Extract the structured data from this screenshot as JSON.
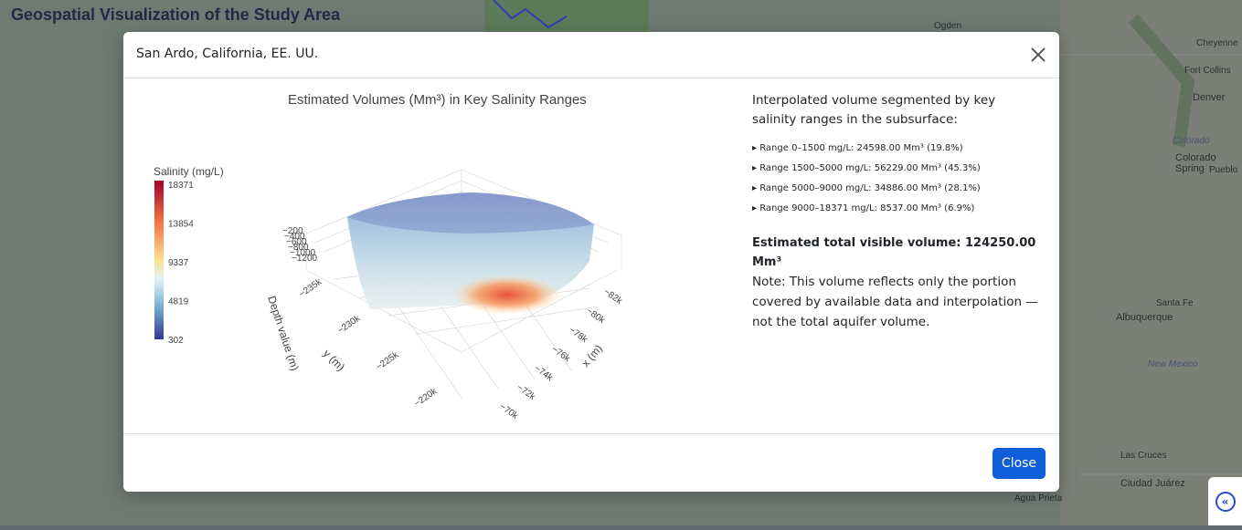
{
  "page": {
    "title": "Geospatial Visualization of the Study Area"
  },
  "map": {
    "labels": [
      "Ogden",
      "Cheyenne",
      "Fort Collins",
      "Denver",
      "Colorado",
      "Colorado Spring",
      "Pueblo",
      "Santa Fe",
      "Albuquerque",
      "New Mexico",
      "Las Cruces",
      "Ciudad Juárez",
      "Agua Prieta"
    ]
  },
  "modal": {
    "title": "San Ardo, California, EE. UU.",
    "close_button": "Close",
    "info": {
      "intro": "Interpolated volume segmented by key salinity ranges in the subsurface:",
      "ranges": [
        "▸ Range 0–1500 mg/L: 24598.00 Mm³ (19.8%)",
        "▸ Range 1500–5000 mg/L: 56229.00 Mm³ (45.3%)",
        "▸ Range 5000–9000 mg/L: 34886.00 Mm³ (28.1%)",
        "▸ Range 9000–18371 mg/L: 8537.00 Mm³ (6.9%)"
      ],
      "total": "Estimated total visible volume: 124250.00 Mm³",
      "note": "Note: This volume reflects only the portion covered by available data and interpolation — not the total aquifer volume."
    }
  },
  "chart_data": {
    "type": "scatter",
    "title": "Estimated Volumes (Mm³) in Key Salinity Ranges",
    "colorbar": {
      "title": "Salinity (mg/L)",
      "ticks": [
        "18371",
        "13854",
        "9337",
        "4819",
        "302"
      ],
      "colors": [
        "#a50026",
        "#f46d43",
        "#fee090",
        "#e0f3f8",
        "#74add1",
        "#313695"
      ]
    },
    "axes": {
      "x": {
        "label": "x (m)",
        "ticks": [
          "−82k",
          "−80k",
          "−78k",
          "−76k",
          "−74k",
          "−72k",
          "−70k"
        ]
      },
      "y": {
        "label": "y (m)",
        "ticks": [
          "−235k",
          "−230k",
          "−225k",
          "−220k"
        ]
      },
      "z": {
        "label": "Depth value (m)",
        "ticks": [
          "−200",
          "−400",
          "−600",
          "−800",
          "−1000",
          "−1200"
        ]
      }
    }
  },
  "colors": {
    "primary_button": "#0d5ed8",
    "page_title": "#1f2a44"
  }
}
